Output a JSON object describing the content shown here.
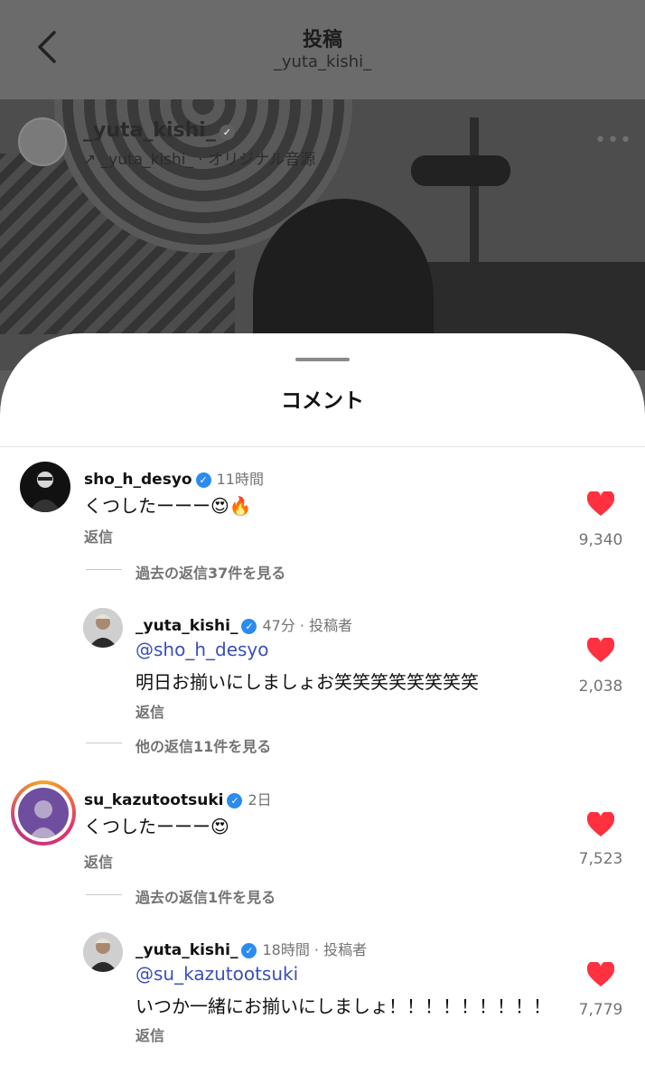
{
  "header": {
    "title": "投稿",
    "subtitle": "_yuta_kishi_"
  },
  "post": {
    "author": "_yuta_kishi_",
    "audio": "↗ _yuta_kishi_ · オリジナル音源",
    "more": "•••"
  },
  "sheet": {
    "title": "コメント"
  },
  "comments": [
    {
      "username": "sho_h_desyo",
      "time": "11時間",
      "text": "くつしたーーー😍🔥",
      "reply": "返信",
      "likes": "9,340",
      "view_more": "過去の返信37件を見る"
    },
    {
      "username": "_yuta_kishi_",
      "time": "47分 · 投稿者",
      "mention": "@sho_h_desyo",
      "text": "明日お揃いにしましょお笑笑笑笑笑笑笑笑",
      "reply": "返信",
      "likes": "2,038",
      "view_more": "他の返信11件を見る"
    },
    {
      "username": "su_kazutootsuki",
      "time": "2日",
      "text": "くつしたーーー😍",
      "reply": "返信",
      "likes": "7,523",
      "view_more": "過去の返信1件を見る"
    },
    {
      "username": "_yuta_kishi_",
      "time": "18時間 · 投稿者",
      "mention": "@su_kazutootsuki",
      "text": "いつか一緒にお揃いにしましょ！！！！！！！！！",
      "reply": "返信",
      "likes": "7,779"
    }
  ],
  "colors": {
    "heart": "#ff3040",
    "verified": "#2b8cf0",
    "mention": "#3b4fb8"
  }
}
